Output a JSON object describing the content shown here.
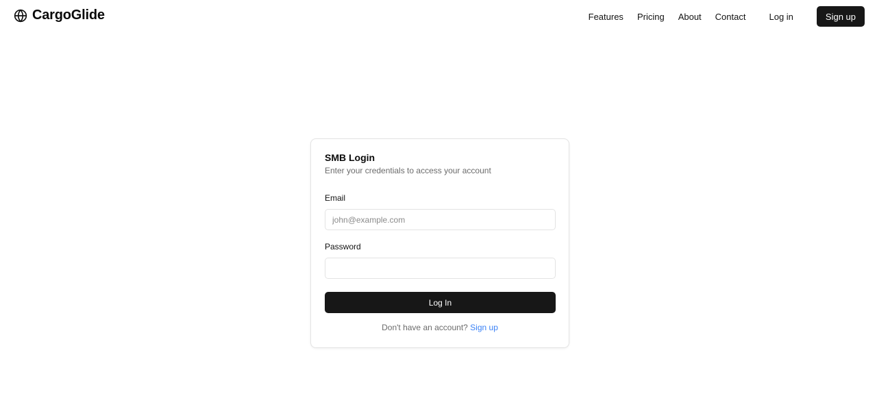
{
  "header": {
    "brand_name": "CargoGlide",
    "brand_icon": "globe-icon",
    "nav": [
      {
        "label": "Features"
      },
      {
        "label": "Pricing"
      },
      {
        "label": "About"
      },
      {
        "label": "Contact"
      }
    ],
    "login_label": "Log in",
    "signup_label": "Sign up"
  },
  "login_card": {
    "title": "SMB Login",
    "subtitle": "Enter your credentials to access your account",
    "email": {
      "label": "Email",
      "placeholder": "john@example.com",
      "value": ""
    },
    "password": {
      "label": "Password",
      "placeholder": "",
      "value": ""
    },
    "submit_label": "Log In",
    "footer_text": "Don't have an account?",
    "footer_link": "Sign up"
  },
  "colors": {
    "primary_button": "#171717",
    "link": "#3b82f6",
    "muted_text": "#6b6b6b",
    "border": "#e3e3e3"
  }
}
